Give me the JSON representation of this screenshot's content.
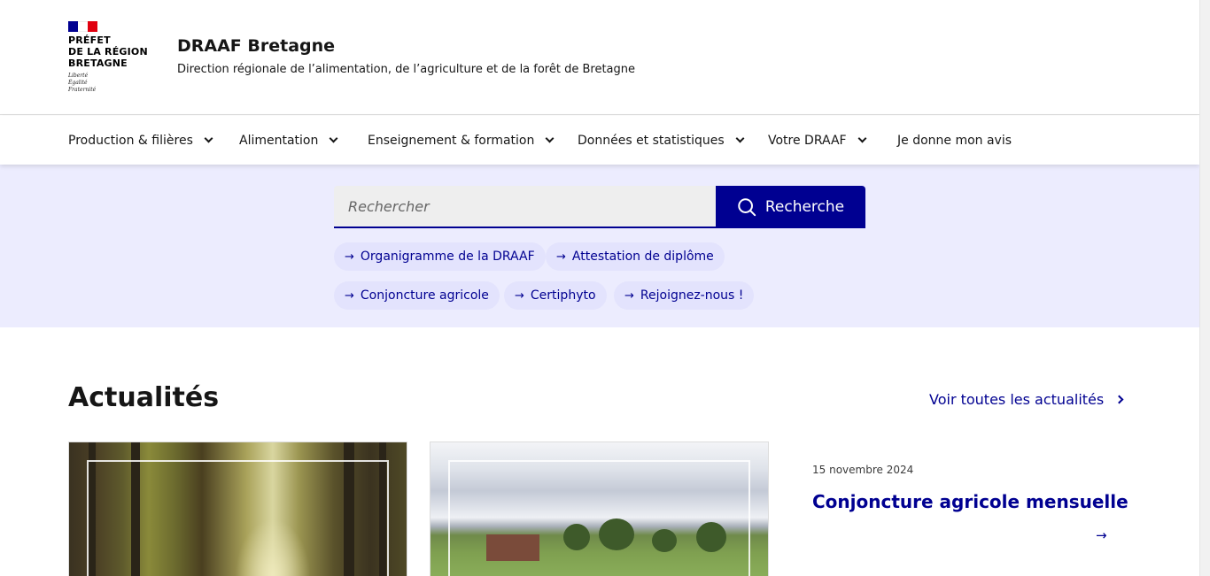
{
  "logo": {
    "line1": "PRÉFET",
    "line2": "DE LA RÉGION",
    "line3": "BRETAGNE",
    "motto1": "Liberté",
    "motto2": "Égalité",
    "motto3": "Fraternité"
  },
  "header": {
    "title": "DRAAF Bretagne",
    "subtitle": "Direction régionale de l’alimentation, de l’agriculture et de la forêt de Bretagne"
  },
  "nav": {
    "items": [
      {
        "label": "Production & filières"
      },
      {
        "label": "Alimentation"
      },
      {
        "label": "Enseignement & formation"
      },
      {
        "label": "Données et statistiques"
      },
      {
        "label": "Votre DRAAF"
      },
      {
        "label": "Je donne mon avis"
      }
    ]
  },
  "search": {
    "placeholder": "Rechercher",
    "button_label": "Recherche"
  },
  "quick_links": [
    {
      "label": "Organigramme de la DRAAF"
    },
    {
      "label": "Attestation de diplôme"
    },
    {
      "label": "Conjoncture agricole"
    },
    {
      "label": "Certiphyto"
    },
    {
      "label": "Rejoignez-nous !"
    }
  ],
  "news": {
    "heading": "Actualités",
    "see_all": "Voir toutes les actualités",
    "featured": {
      "date": "15 novembre 2024",
      "title": "Conjoncture agricole mensuelle"
    }
  },
  "colors": {
    "primary": "#000091",
    "band": "#ececfe",
    "tag_bg": "#e3e3fd"
  },
  "icons": {
    "search": "magnifier",
    "arrow": "arrow-right",
    "chevron": "chevron-down"
  }
}
